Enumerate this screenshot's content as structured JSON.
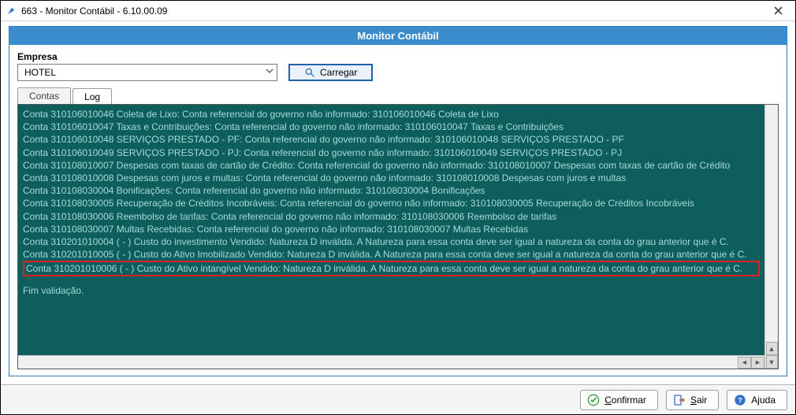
{
  "window": {
    "title": "663 - Monitor Contábil - 6.10.00.09"
  },
  "panel": {
    "header": "Monitor Contábil"
  },
  "filter": {
    "empresa_label": "Empresa",
    "empresa_value": "HOTEL",
    "carregar_label": "Carregar"
  },
  "tabs": {
    "contas": "Contas",
    "log": "Log"
  },
  "log_lines": {
    "l0": "Conta 310106010046 Coleta de Lixo: Conta referencial do governo não informado: 310106010046  Coleta de Lixo",
    "l1": "Conta 310106010047 Taxas e Contribuições: Conta referencial do governo não informado: 310106010047  Taxas e Contribuições",
    "l2": "Conta 310106010048 SERVIÇOS PRESTADO - PF: Conta referencial do governo não informado: 310106010048  SERVIÇOS PRESTADO - PF",
    "l3": "Conta 310106010049 SERVIÇOS PRESTADO - PJ: Conta referencial do governo não informado: 310106010049  SERVIÇOS PRESTADO - PJ",
    "l4": "Conta 310108010007 Despesas com taxas de cartão de Crédito: Conta referencial do governo não informado: 310108010007  Despesas com taxas de cartão de Crédito",
    "l5": "Conta 310108010008 Despesas com juros e multas: Conta referencial do governo não informado: 310108010008  Despesas com juros e multas",
    "l6": "Conta 310108030004 Bonificações: Conta referencial do governo não informado: 310108030004  Bonificações",
    "l7": "Conta 310108030005 Recuperação de Créditos Incobráveis: Conta referencial do governo não informado: 310108030005  Recuperação de Créditos Incobráveis",
    "l8": "Conta 310108030006 Reembolso de tarifas: Conta referencial do governo não informado: 310108030006  Reembolso de tarifas",
    "l9": "Conta 310108030007 Multas Recebidas: Conta referencial do governo não informado: 310108030007  Multas Recebidas",
    "l10": "Conta 310201010004 ( - ) Custo do investimento Vendido:  Natureza D inválida. A Natureza para essa conta deve ser igual a natureza da conta do grau anterior que é C.",
    "l11": "Conta 310201010005 ( - ) Custo do Ativo Imobilizado Vendido:  Natureza D inválida. A Natureza para essa conta deve ser igual a natureza da conta do grau anterior que é C.",
    "l12": "Conta 310201010006 ( - ) Custo do Ativo intangível Vendido:  Natureza D inválida. A Natureza para essa conta deve ser igual a natureza da conta do grau anterior que é C.",
    "l13": "Fim validação."
  },
  "footer": {
    "confirmar": "Confirmar",
    "sair": "Sair",
    "ajuda": "Ajuda"
  }
}
